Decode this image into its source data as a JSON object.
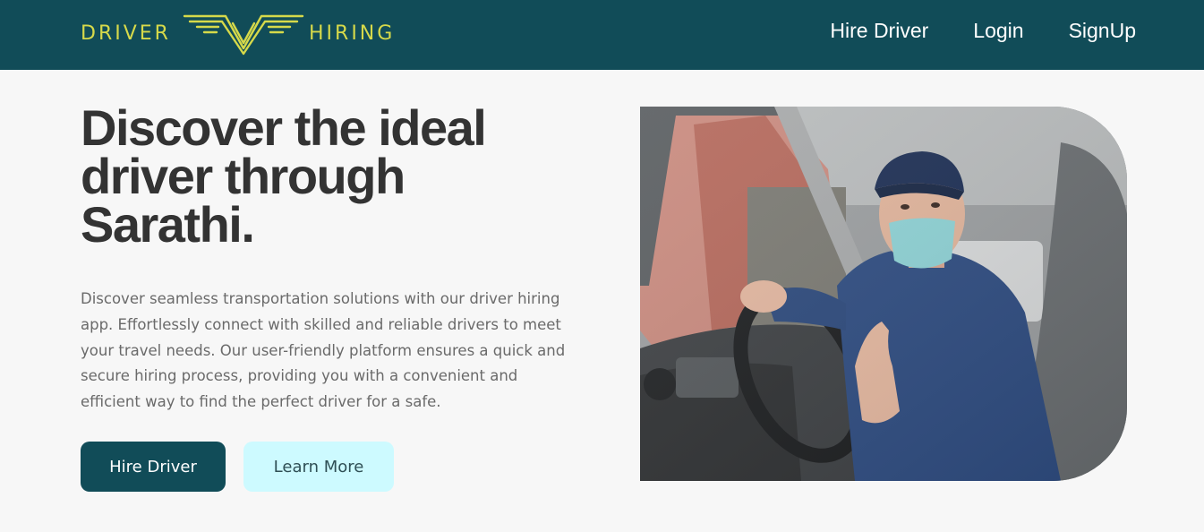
{
  "brand": {
    "left_text": "DRIVER",
    "right_text": "HIRING",
    "accent_color": "#d6d94a",
    "logo_icon": "wings-v-icon"
  },
  "nav": {
    "background_color": "#114c58",
    "items": [
      {
        "label": "Hire Driver"
      },
      {
        "label": "Login"
      },
      {
        "label": "SignUp"
      }
    ]
  },
  "hero": {
    "title": "Discover the ideal driver through Sarathi.",
    "description": "Discover seamless transportation solutions with our driver hiring app. Effortlessly connect with skilled and reliable drivers to meet your travel needs. Our user-friendly platform ensures a quick and secure hiring process, providing you with a convenient and efficient way to find the perfect driver for a safe.",
    "primary_button": "Hire Driver",
    "secondary_button": "Learn More",
    "image": "driver-photo"
  }
}
